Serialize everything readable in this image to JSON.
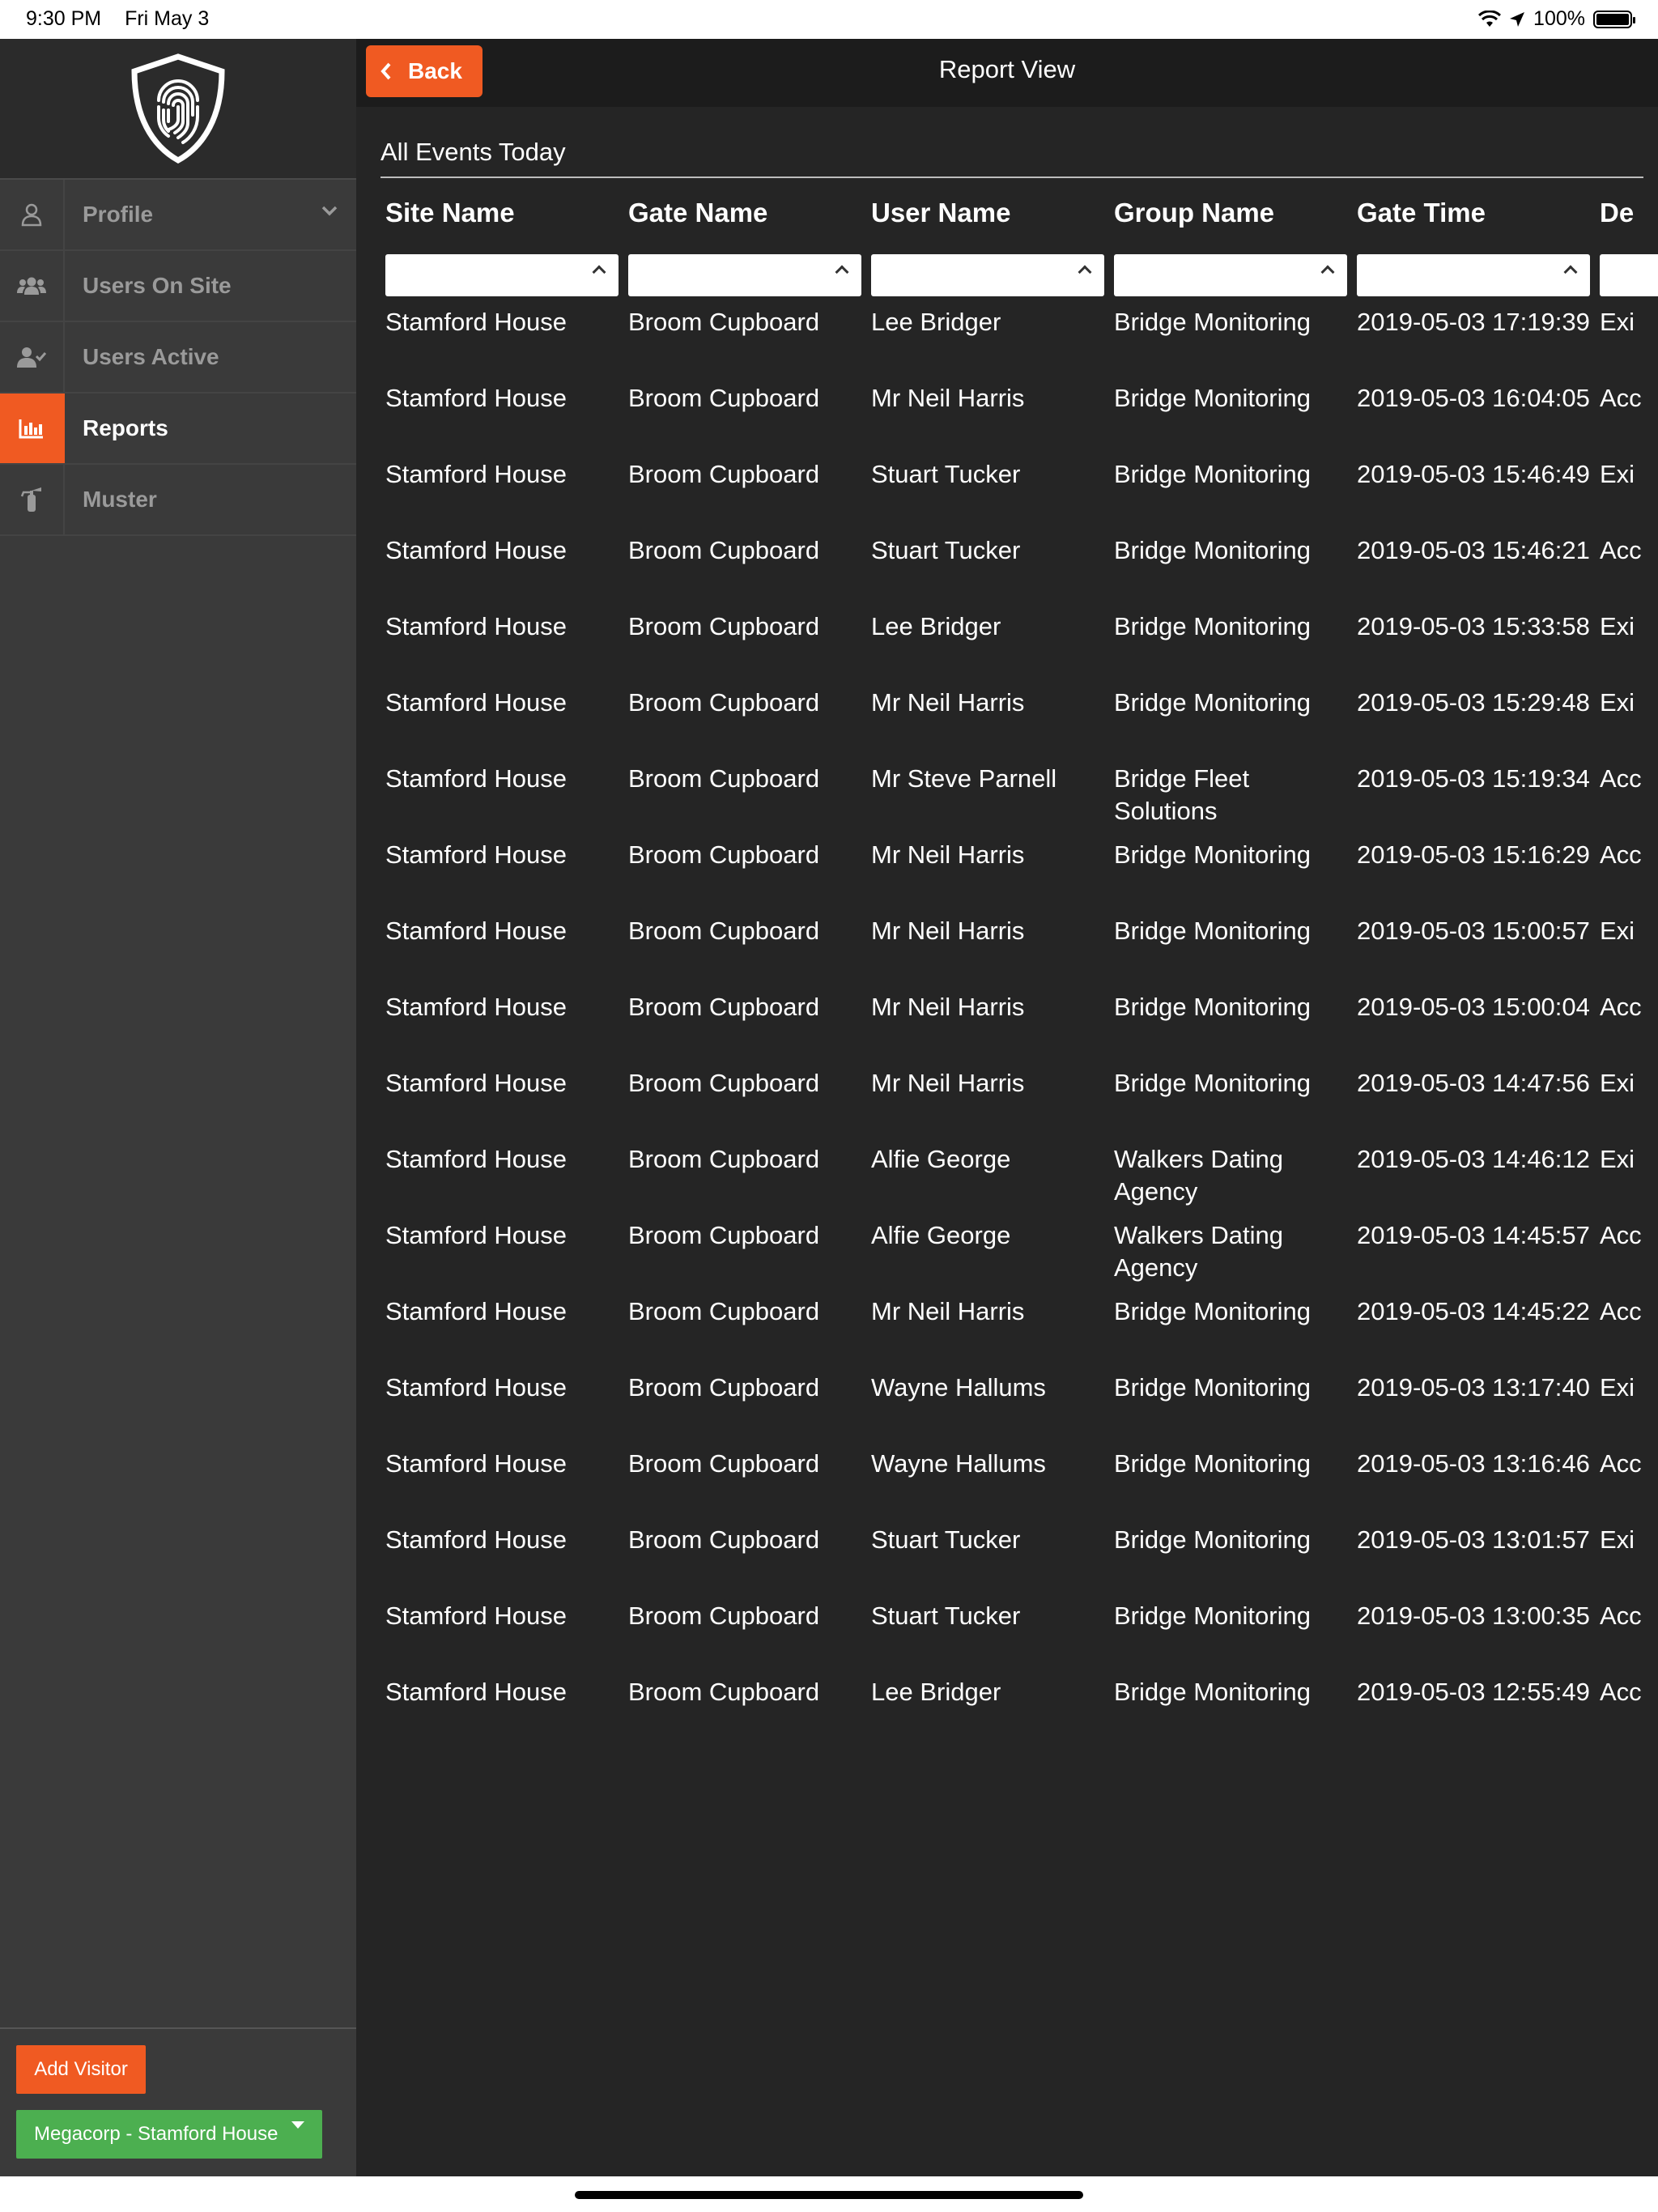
{
  "status_bar": {
    "time": "9:30 PM",
    "date": "Fri May 3",
    "battery": "100%"
  },
  "sidebar": {
    "logo": "fingerprint-shield-logo",
    "items": [
      {
        "label": "Profile",
        "icon": "user-icon"
      },
      {
        "label": "Users On Site",
        "icon": "users-icon"
      },
      {
        "label": "Users Active",
        "icon": "user-check-icon"
      },
      {
        "label": "Reports",
        "icon": "bar-chart-icon"
      },
      {
        "label": "Muster",
        "icon": "fire-extinguisher-icon"
      }
    ],
    "active_item": "Reports",
    "add_visitor_label": "Add Visitor",
    "site_select_value": "Megacorp - Stamford House"
  },
  "topbar": {
    "back_label": "Back",
    "title": "Report View"
  },
  "report": {
    "section_title": "All Events Today",
    "columns": [
      "Site Name",
      "Gate Name",
      "User Name",
      "Group Name",
      "Gate Time",
      "De"
    ],
    "rows": [
      [
        "Stamford House",
        "Broom Cupboard",
        "Lee Bridger",
        "Bridge Monitoring",
        "2019-05-03 17:19:39",
        "Exi"
      ],
      [
        "Stamford House",
        "Broom Cupboard",
        "Mr Neil Harris",
        "Bridge Monitoring",
        "2019-05-03 16:04:05",
        "Acc"
      ],
      [
        "Stamford House",
        "Broom Cupboard",
        "Stuart Tucker",
        "Bridge Monitoring",
        "2019-05-03 15:46:49",
        "Exi"
      ],
      [
        "Stamford House",
        "Broom Cupboard",
        "Stuart Tucker",
        "Bridge Monitoring",
        "2019-05-03 15:46:21",
        "Acc"
      ],
      [
        "Stamford House",
        "Broom Cupboard",
        "Lee Bridger",
        "Bridge Monitoring",
        "2019-05-03 15:33:58",
        "Exi"
      ],
      [
        "Stamford House",
        "Broom Cupboard",
        "Mr Neil Harris",
        "Bridge Monitoring",
        "2019-05-03 15:29:48",
        "Exi"
      ],
      [
        "Stamford House",
        "Broom Cupboard",
        "Mr Steve Parnell",
        "Bridge Fleet Solutions",
        "2019-05-03 15:19:34",
        "Acc"
      ],
      [
        "Stamford House",
        "Broom Cupboard",
        "Mr Neil Harris",
        "Bridge Monitoring",
        "2019-05-03 15:16:29",
        "Acc"
      ],
      [
        "Stamford House",
        "Broom Cupboard",
        "Mr Neil Harris",
        "Bridge Monitoring",
        "2019-05-03 15:00:57",
        "Exi"
      ],
      [
        "Stamford House",
        "Broom Cupboard",
        "Mr Neil Harris",
        "Bridge Monitoring",
        "2019-05-03 15:00:04",
        "Acc"
      ],
      [
        "Stamford House",
        "Broom Cupboard",
        "Mr Neil Harris",
        "Bridge Monitoring",
        "2019-05-03 14:47:56",
        "Exi"
      ],
      [
        "Stamford House",
        "Broom Cupboard",
        "Alfie George",
        "Walkers Dating Agency",
        "2019-05-03 14:46:12",
        "Exi"
      ],
      [
        "Stamford House",
        "Broom Cupboard",
        "Alfie George",
        "Walkers Dating Agency",
        "2019-05-03 14:45:57",
        "Acc"
      ],
      [
        "Stamford House",
        "Broom Cupboard",
        "Mr Neil Harris",
        "Bridge Monitoring",
        "2019-05-03 14:45:22",
        "Acc"
      ],
      [
        "Stamford House",
        "Broom Cupboard",
        "Wayne Hallums",
        "Bridge Monitoring",
        "2019-05-03 13:17:40",
        "Exi"
      ],
      [
        "Stamford House",
        "Broom Cupboard",
        "Wayne Hallums",
        "Bridge Monitoring",
        "2019-05-03 13:16:46",
        "Acc"
      ],
      [
        "Stamford House",
        "Broom Cupboard",
        "Stuart Tucker",
        "Bridge Monitoring",
        "2019-05-03 13:01:57",
        "Exi"
      ],
      [
        "Stamford House",
        "Broom Cupboard",
        "Stuart Tucker",
        "Bridge Monitoring",
        "2019-05-03 13:00:35",
        "Acc"
      ],
      [
        "Stamford House",
        "Broom Cupboard",
        "Lee Bridger",
        "Bridge Monitoring",
        "2019-05-03 12:55:49",
        "Acc"
      ]
    ]
  },
  "colors": {
    "accent": "#f05a22",
    "site_select": "#4caf50",
    "sidebar_bg": "#3a3a3a",
    "main_bg": "#252525"
  }
}
